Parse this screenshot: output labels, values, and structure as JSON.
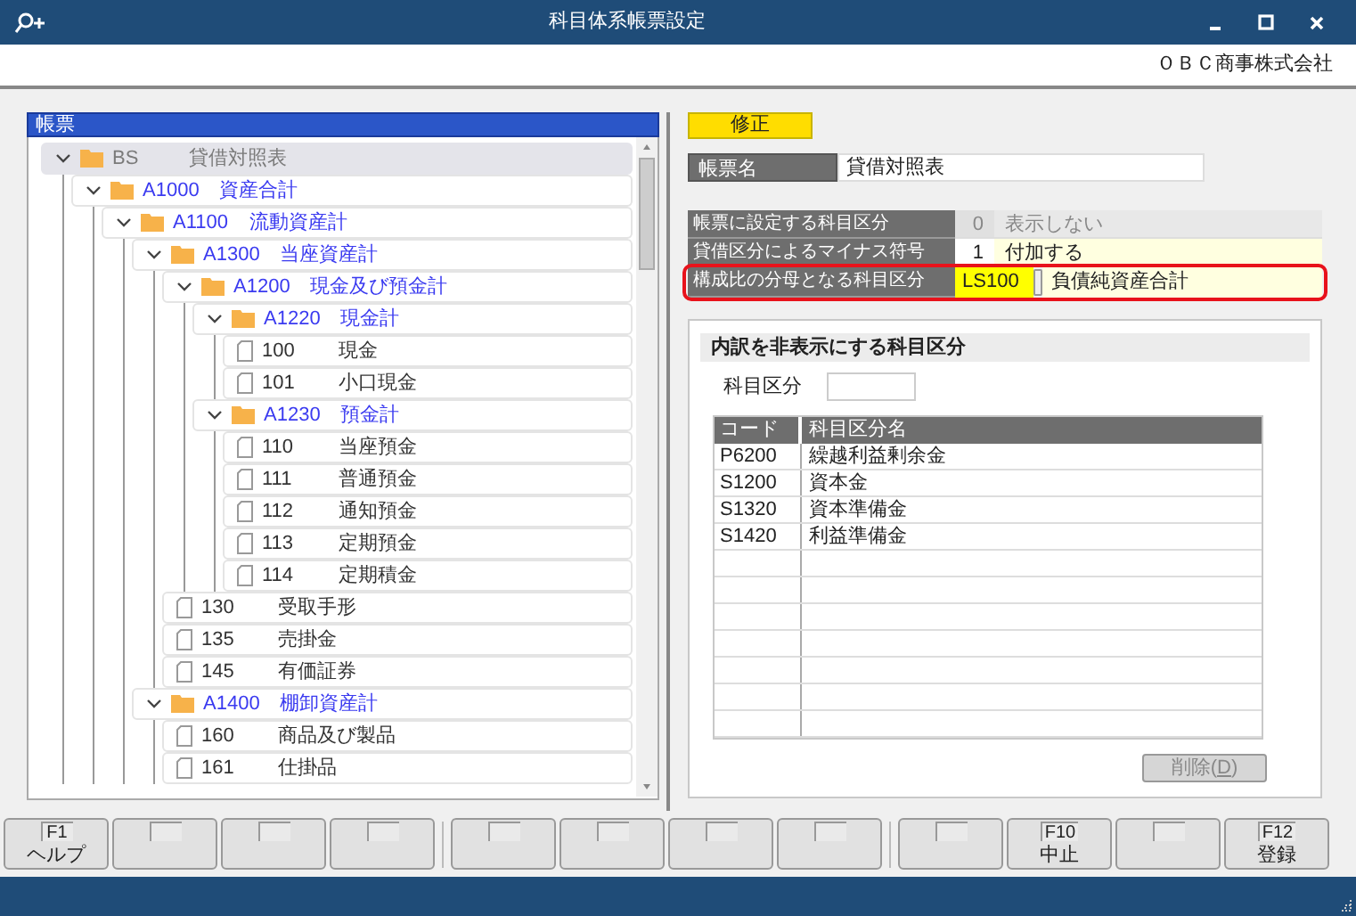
{
  "window": {
    "title": "科目体系帳票設定",
    "company": "ＯＢＣ商事株式会社"
  },
  "tree": {
    "header": "帳票",
    "items": [
      {
        "kind": "folder",
        "code": "BS",
        "name": "貸借対照表",
        "selected": true,
        "expanded": true,
        "children": [
          {
            "kind": "folder",
            "code": "A1000",
            "name": "資産合計",
            "selected": false,
            "expanded": true,
            "children": [
              {
                "kind": "folder",
                "code": "A1100",
                "name": "流動資産計",
                "selected": false,
                "expanded": true,
                "children": [
                  {
                    "kind": "folder",
                    "code": "A1300",
                    "name": "当座資産計",
                    "selected": false,
                    "expanded": true,
                    "children": [
                      {
                        "kind": "folder",
                        "code": "A1200",
                        "name": "現金及び預金計",
                        "selected": false,
                        "expanded": true,
                        "children": [
                          {
                            "kind": "folder",
                            "code": "A1220",
                            "name": "現金計",
                            "selected": false,
                            "expanded": true,
                            "children": [
                              {
                                "kind": "leaf",
                                "code": "100",
                                "name": "現金",
                                "selected": false
                              },
                              {
                                "kind": "leaf",
                                "code": "101",
                                "name": "小口現金",
                                "selected": false
                              }
                            ]
                          },
                          {
                            "kind": "folder",
                            "code": "A1230",
                            "name": "預金計",
                            "selected": false,
                            "expanded": true,
                            "children": [
                              {
                                "kind": "leaf",
                                "code": "110",
                                "name": "当座預金",
                                "selected": false
                              },
                              {
                                "kind": "leaf",
                                "code": "111",
                                "name": "普通預金",
                                "selected": false
                              },
                              {
                                "kind": "leaf",
                                "code": "112",
                                "name": "通知預金",
                                "selected": false
                              },
                              {
                                "kind": "leaf",
                                "code": "113",
                                "name": "定期預金",
                                "selected": false
                              },
                              {
                                "kind": "leaf",
                                "code": "114",
                                "name": "定期積金",
                                "selected": false
                              }
                            ]
                          }
                        ]
                      },
                      {
                        "kind": "leaf",
                        "code": "130",
                        "name": "受取手形",
                        "selected": false
                      },
                      {
                        "kind": "leaf",
                        "code": "135",
                        "name": "売掛金",
                        "selected": false
                      },
                      {
                        "kind": "leaf",
                        "code": "145",
                        "name": "有価証券",
                        "selected": false
                      }
                    ]
                  },
                  {
                    "kind": "folder",
                    "code": "A1400",
                    "name": "棚卸資産計",
                    "selected": false,
                    "expanded": true,
                    "children": [
                      {
                        "kind": "leaf",
                        "code": "160",
                        "name": "商品及び製品",
                        "selected": false
                      },
                      {
                        "kind": "leaf",
                        "code": "161",
                        "name": "仕掛品",
                        "selected": false
                      }
                    ]
                  }
                ]
              }
            ]
          }
        ]
      }
    ]
  },
  "mode_badge": "修正",
  "report_name": {
    "label": "帳票名",
    "value": "貸借対照表"
  },
  "settings": [
    {
      "label": "帳票に設定する科目区分",
      "code": "0",
      "value": "表示しない",
      "disabled": true,
      "highlighted": false
    },
    {
      "label": "貸借区分によるマイナス符号",
      "code": "1",
      "value": "付加する",
      "disabled": false,
      "highlighted": false
    },
    {
      "label": "構成比の分母となる科目区分",
      "code": "LS100",
      "value": "負債純資産合計",
      "disabled": false,
      "highlighted": true,
      "kind": "lookup"
    }
  ],
  "hidden_group": {
    "title": "内訳を非表示にする科目区分",
    "field_label": "科目区分",
    "columns": [
      "コード",
      "科目区分名"
    ],
    "rows": [
      [
        "P6200",
        "繰越利益剰余金"
      ],
      [
        "S1200",
        "資本金"
      ],
      [
        "S1320",
        "資本準備金"
      ],
      [
        "S1420",
        "利益準備金"
      ]
    ],
    "delete_button": {
      "label_before": "削除(",
      "accelerator": "D",
      "label_after": ")",
      "disabled": true
    }
  },
  "function_keys": [
    {
      "kind": "key",
      "key": "F1",
      "label": "ヘルプ"
    },
    {
      "kind": "blank"
    },
    {
      "kind": "blank"
    },
    {
      "kind": "blank"
    },
    {
      "kind": "blank"
    },
    {
      "kind": "blank"
    },
    {
      "kind": "blank"
    },
    {
      "kind": "blank"
    },
    {
      "kind": "blank"
    },
    {
      "kind": "key",
      "key": "F10",
      "label": "中止"
    },
    {
      "kind": "blank"
    },
    {
      "kind": "key",
      "key": "F12",
      "label": "登録"
    }
  ]
}
